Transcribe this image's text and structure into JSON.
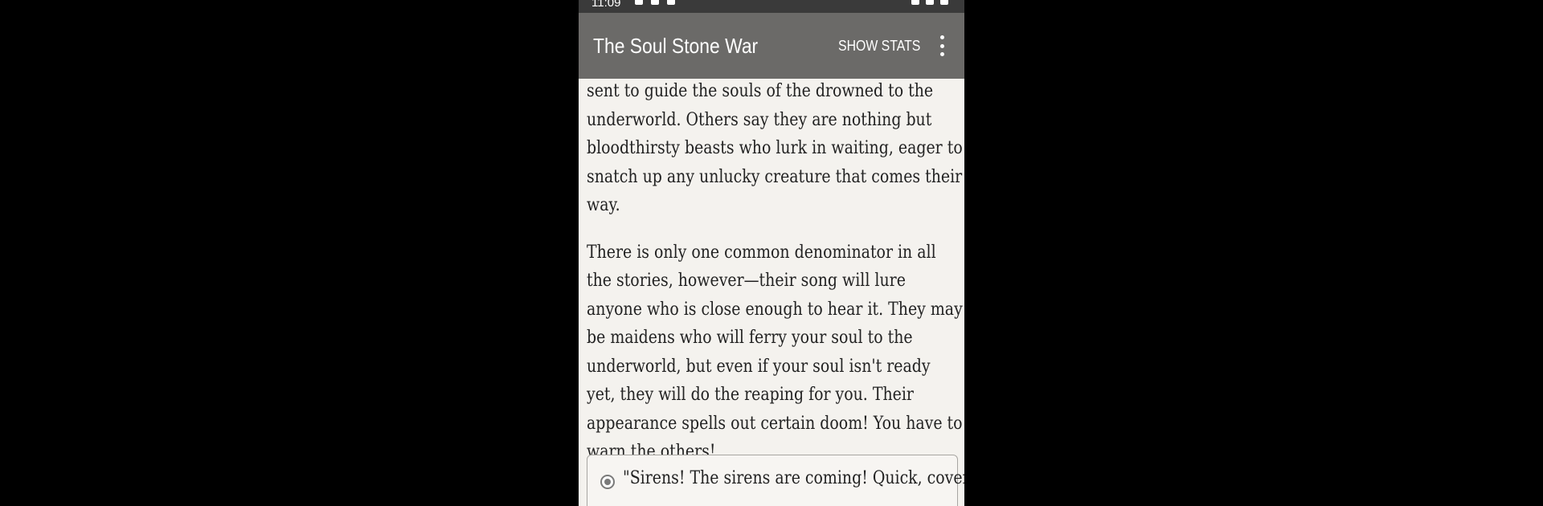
{
  "status_bar": {
    "time": "11:09"
  },
  "app_bar": {
    "title": "The Soul Stone War",
    "show_stats_label": "SHOW STATS"
  },
  "story": {
    "paragraphs": [
      "sent to guide the souls of the drowned to the underworld. Others say they are nothing but bloodthirsty beasts who lurk in waiting, eager to snatch up any unlucky creature that comes their way.",
      "There is only one common denominator in all the stories, however—their song will lure anyone who is close enough to hear it. They may be maidens who will ferry your soul to the underworld, but even if your soul isn't ready yet, they will do the reaping for you. Their appearance spells out certain doom! You have to warn the others!"
    ]
  },
  "choices": [
    {
      "text": "\"Sirens! The sirens are coming! Quick, cover"
    }
  ]
}
